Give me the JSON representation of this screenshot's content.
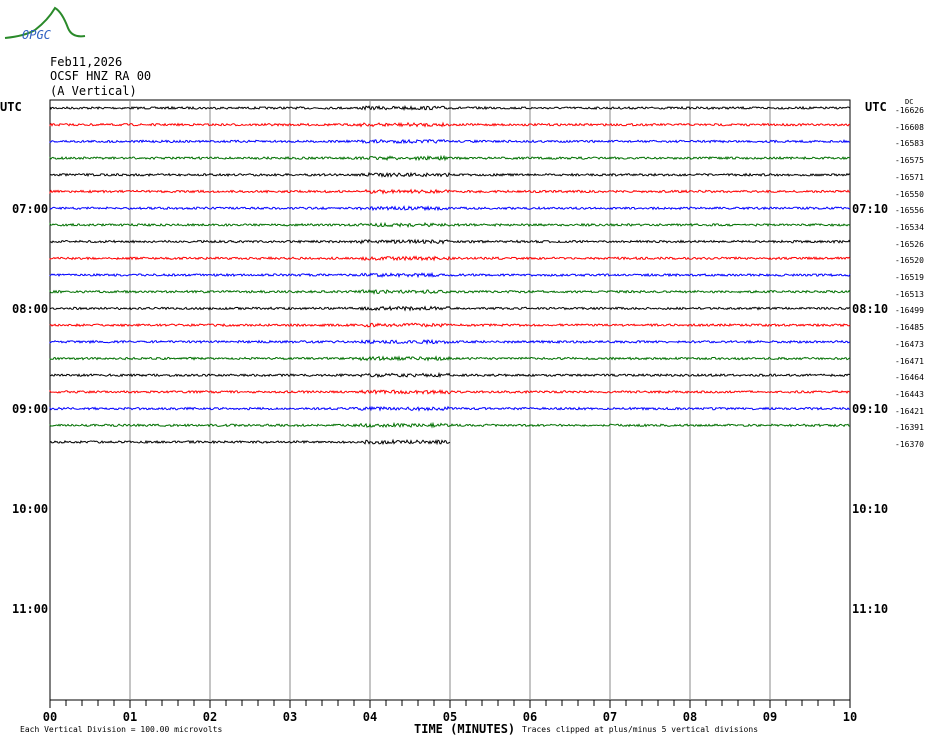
{
  "logo_text": "OPGC",
  "header": {
    "date": "Feb11,2026",
    "station": "OCSF HNZ RA 00",
    "component": "(A Vertical)"
  },
  "chart_data": {
    "type": "line",
    "title": "Feb11,2026 OCSF HNZ RA 00 (A Vertical)",
    "xlabel": "TIME (MINUTES)",
    "x_ticks": [
      "00",
      "01",
      "02",
      "03",
      "04",
      "05",
      "06",
      "07",
      "08",
      "09",
      "10"
    ],
    "xlim": [
      0,
      10
    ],
    "left_axis_title": "UTC",
    "right_axis_title": "UTC",
    "left_hour_labels": [
      "07:00",
      "08:00",
      "09:00",
      "10:00",
      "11:00"
    ],
    "right_hour_labels": [
      "07:10",
      "08:10",
      "09:10",
      "10:10",
      "11:10"
    ],
    "dc_header": "DC",
    "dc_offsets": [
      -16626,
      -16608,
      -16583,
      -16575,
      -16571,
      -16550,
      -16556,
      -16534,
      -16526,
      -16520,
      -16519,
      -16513,
      -16499,
      -16485,
      -16473,
      -16471,
      -16464,
      -16443,
      -16421,
      -16391,
      -16370
    ],
    "trace_colors": [
      "#000000",
      "#ff0000",
      "#0000ff",
      "#007000"
    ],
    "trace_count": 21,
    "last_trace_end_minute": 5,
    "grid": true,
    "footer_left": "Each Vertical Division =  100.00 microvolts",
    "footer_right": "Traces clipped at plus/minus 5 vertical divisions"
  }
}
